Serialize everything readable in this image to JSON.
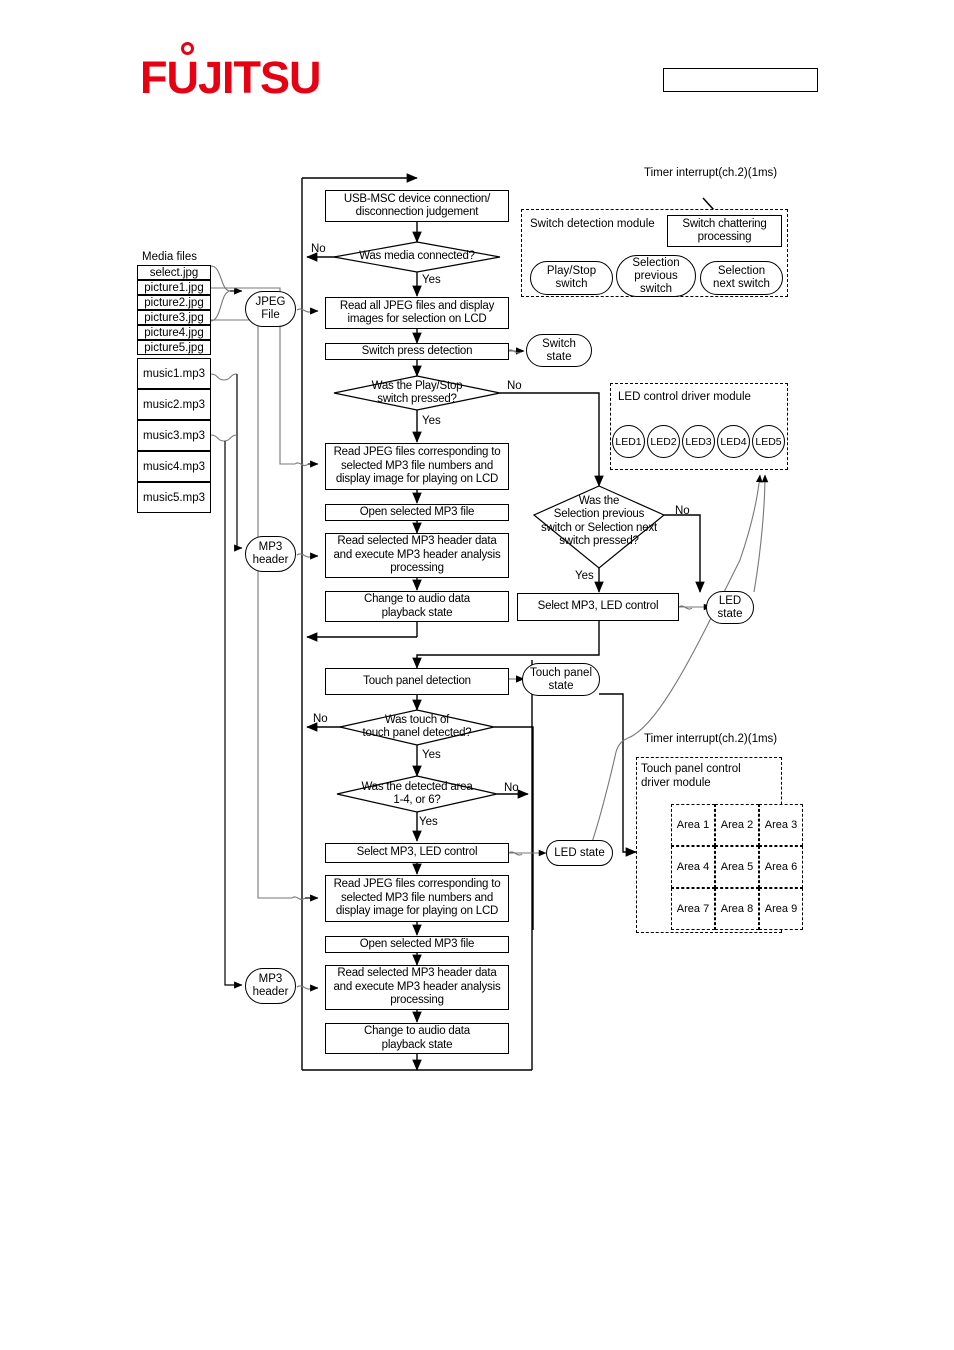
{
  "page": {
    "logo_text": "FUJITSU",
    "header_box_text": ""
  },
  "media_files": {
    "title": "Media files",
    "items": [
      {
        "name": "select.jpg",
        "type": "jpg"
      },
      {
        "name": "picture1.jpg",
        "type": "jpg"
      },
      {
        "name": "picture2.jpg",
        "type": "jpg"
      },
      {
        "name": "picture3.jpg",
        "type": "jpg"
      },
      {
        "name": "picture4.jpg",
        "type": "jpg"
      },
      {
        "name": "picture5.jpg",
        "type": "jpg"
      },
      {
        "name": "music1.mp3",
        "type": "mp3"
      },
      {
        "name": "music2.mp3",
        "type": "mp3"
      },
      {
        "name": "music3.mp3",
        "type": "mp3"
      },
      {
        "name": "music4.mp3",
        "type": "mp3"
      },
      {
        "name": "music5.mp3",
        "type": "mp3"
      }
    ]
  },
  "connectors": {
    "jpeg_file": "JPEG\nFile",
    "mp3_header_upper": "MP3\nheader",
    "mp3_header_lower": "MP3\nheader",
    "switch_state": "Switch\nstate",
    "led_state_upper": "LED\nstate",
    "led_state_lower": "LED state",
    "touch_panel_state": "Touch panel\nstate"
  },
  "flow": {
    "process_1": "USB-MSC device connection/\ndisconnection judgement",
    "decision_1": "Was media connected?",
    "process_2": "Read all JPEG files and display\nimages for selection on LCD",
    "process_3": "Switch press detection",
    "decision_2": "Was the Play/Stop\nswitch pressed?",
    "process_4": "Read JPEG files corresponding to\nselected MP3 file numbers and\ndisplay image for playing on LCD",
    "process_5": "Open selected MP3 file",
    "process_6": "Read selected MP3 header data\nand execute MP3 header analysis\nprocessing",
    "process_7": "Change to audio data\nplayback state",
    "decision_3": "Was the\nSelection previous\nswitch or Selection next\nswitch pressed?",
    "process_8": "Select MP3, LED control",
    "process_9": "Touch panel detection",
    "decision_4": "Was touch of\ntouch panel detected?",
    "decision_5": "Was the detected area\n1-4, or 6?",
    "process_10": "Select MP3, LED control",
    "process_11": "Read JPEG files corresponding to\nselected MP3 file numbers and\ndisplay image for playing on LCD",
    "process_12": "Open selected MP3 file",
    "process_13": "Read selected MP3 header data\nand execute MP3 header analysis\nprocessing",
    "process_14": "Change to audio data\nplayback state"
  },
  "branch_labels": {
    "no_1": "No",
    "yes_1": "Yes",
    "no_2": "No",
    "yes_2": "Yes",
    "no_3": "No",
    "yes_3": "Yes",
    "no_4": "No",
    "yes_4": "Yes",
    "no_5": "No",
    "yes_5": "Yes"
  },
  "switch_module": {
    "title": "Switch detection module",
    "chattering": "Switch chattering\nprocessing",
    "timer_interrupt": "Timer interrupt(ch.2)(1ms)",
    "switches": [
      "Play/Stop\nswitch",
      "Selection\nprevious\nswitch",
      "Selection\nnext switch"
    ]
  },
  "led_module": {
    "title": "LED control driver module",
    "leds": [
      "LED1",
      "LED2",
      "LED3",
      "LED4",
      "LED5"
    ]
  },
  "touch_module": {
    "title": "Touch panel control\ndriver module",
    "timer_interrupt": "Timer interrupt(ch.2)(1ms)",
    "areas": [
      "Area 1",
      "Area 2",
      "Area 3",
      "Area 4",
      "Area 5",
      "Area 6",
      "Area 7",
      "Area 8",
      "Area 9"
    ]
  },
  "colors": {
    "brand_red": "#e60012",
    "line": "#000000",
    "thin_line": "#808080"
  }
}
